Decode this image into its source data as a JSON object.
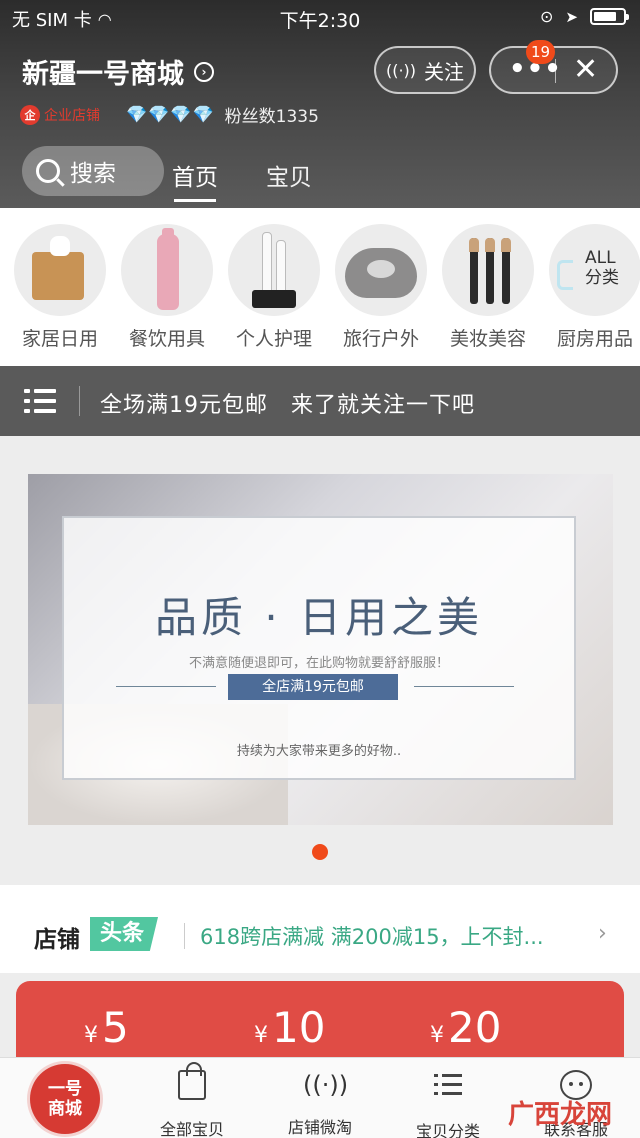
{
  "status_bar": {
    "carrier": "无 SIM 卡",
    "time": "下午2:30"
  },
  "store": {
    "name": "新疆一号商城",
    "follow_label": "关注",
    "notification_count": "19",
    "enterprise_badge": "企",
    "enterprise_label": "企业店铺",
    "diamonds": "💎💎💎💎",
    "fans": "粉丝数1335"
  },
  "nav": {
    "search_label": "搜索",
    "tabs": [
      "首页",
      "宝贝"
    ]
  },
  "categories": [
    {
      "label": "家居日用",
      "icon": "tissue-box-icon"
    },
    {
      "label": "餐饮用具",
      "icon": "bottle-icon"
    },
    {
      "label": "个人护理",
      "icon": "toothbrush-icon"
    },
    {
      "label": "旅行户外",
      "icon": "neck-pillow-icon"
    },
    {
      "label": "美妆美容",
      "icon": "makeup-brush-icon"
    },
    {
      "label": "厨房用品",
      "icon": "all-categories-icon",
      "all_text": "ALL",
      "all_sub": "分类"
    }
  ],
  "announcement": {
    "text": "全场满19元包邮　来了就关注一下吧"
  },
  "banner": {
    "title": "品质 · 日用之美",
    "subtitle": "不满意随便退即可，在此购物就要舒舒服服！",
    "tag": "全店满19元包邮",
    "footer": "持续为大家带来更多的好物.."
  },
  "headline": {
    "shop": "店铺",
    "tag": "头条",
    "text": "618跨店满减 满200减15，上不封..."
  },
  "coupons": [
    {
      "currency": "¥",
      "amount": "5"
    },
    {
      "currency": "¥",
      "amount": "10"
    },
    {
      "currency": "¥",
      "amount": "20"
    }
  ],
  "tabbar": {
    "logo_line1": "一号",
    "logo_line2": "商城",
    "items": [
      "全部宝贝",
      "店铺微淘",
      "宝贝分类",
      "联系客服"
    ]
  },
  "watermark": {
    "text": "广西龙网"
  },
  "colors": {
    "accent": "#f04a1a",
    "coupon_red": "#e04c45",
    "headline_green": "#52c7a0",
    "banner_blue": "#4d6c98"
  }
}
